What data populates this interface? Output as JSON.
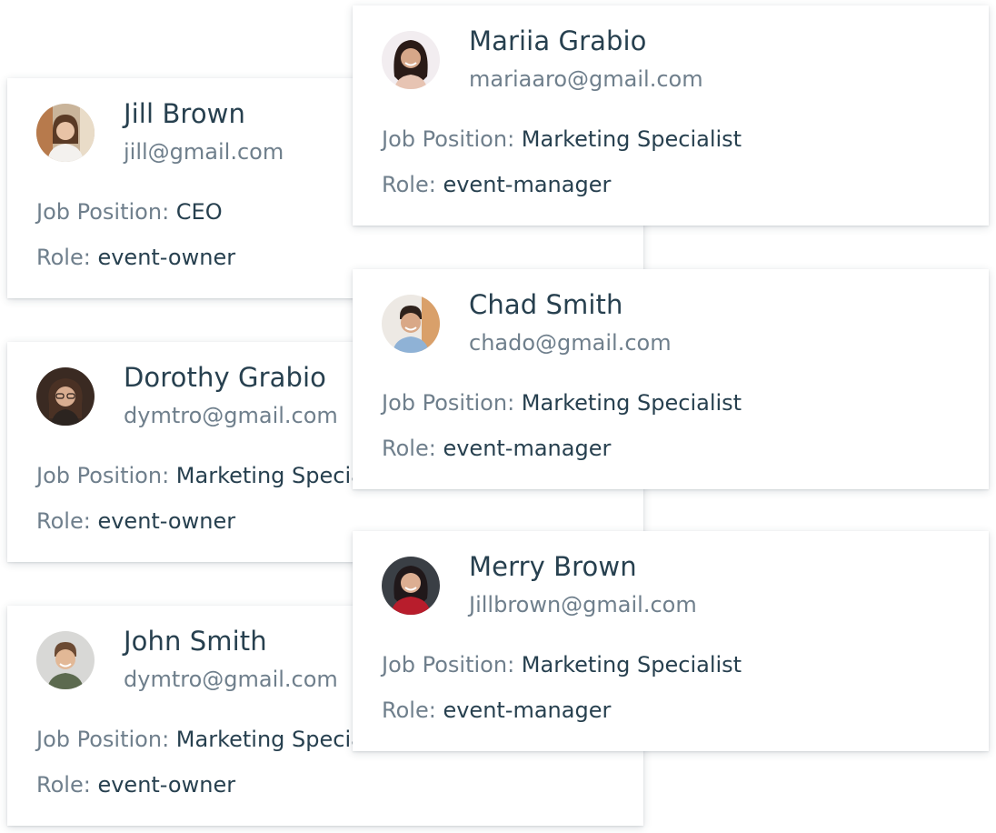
{
  "labels": {
    "job_position": "Job Position:",
    "role": "Role:"
  },
  "cards": [
    {
      "name": "Jill Brown",
      "email": "jill@gmail.com",
      "job_position": "CEO",
      "role": "event-owner"
    },
    {
      "name": "Dorothy Grabio",
      "email": "dymtro@gmail.com",
      "job_position": "Marketing Specialist",
      "role": "event-owner"
    },
    {
      "name": "John Smith",
      "email": "dymtro@gmail.com",
      "job_position": "Marketing Specialist",
      "role": "event-owner"
    },
    {
      "name": "Mariia Grabio",
      "email": "mariaaro@gmail.com",
      "job_position": "Marketing Specialist",
      "role": "event-manager"
    },
    {
      "name": "Chad Smith",
      "email": "chado@gmail.com",
      "job_position": "Marketing Specialist",
      "role": "event-manager"
    },
    {
      "name": "Merry Brown",
      "email": "Jillbrown@gmail.com",
      "job_position": "Marketing Specialist",
      "role": "event-manager"
    }
  ]
}
